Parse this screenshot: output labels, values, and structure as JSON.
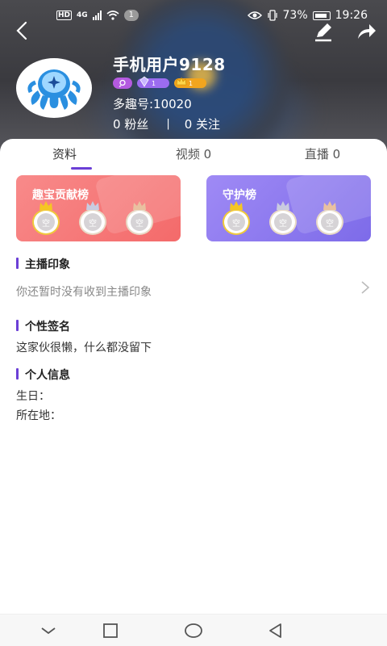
{
  "status_bar": {
    "hd": "HD",
    "network": "4G",
    "notification_count": "1",
    "battery_percent": "73%",
    "time": "19:26"
  },
  "profile": {
    "username": "手机用户9128",
    "user_id": "多趣号:10020",
    "fans": "0 粉丝",
    "following": "0 关注",
    "badges": {
      "level_purple": "1",
      "level_gold": "1"
    }
  },
  "tabs": [
    {
      "label": "资料",
      "active": true
    },
    {
      "label": "视频 0",
      "active": false
    },
    {
      "label": "直播 0",
      "active": false
    }
  ],
  "cards": {
    "contribution": {
      "title": "趣宝贡献榜",
      "slots": [
        "空",
        "空",
        "空"
      ]
    },
    "guard": {
      "title": "守护榜",
      "slots": [
        "空",
        "空",
        "空"
      ]
    }
  },
  "sections": {
    "impression": {
      "title": "主播印象",
      "text": "你还暂时没有收到主播印象"
    },
    "signature": {
      "title": "个性签名",
      "text": "这家伙很懒，什么都没留下"
    },
    "info": {
      "title": "个人信息",
      "birthday": "生日：",
      "location": "所在地："
    }
  },
  "colors": {
    "accent": "#6b3fd6",
    "contribution_card": "#f46a6a",
    "guard_card": "#7d6be9"
  },
  "icons": [
    "back-arrow-icon",
    "edit-pen-icon",
    "share-arrow-icon",
    "chevron-right-icon",
    "crown-icon"
  ]
}
